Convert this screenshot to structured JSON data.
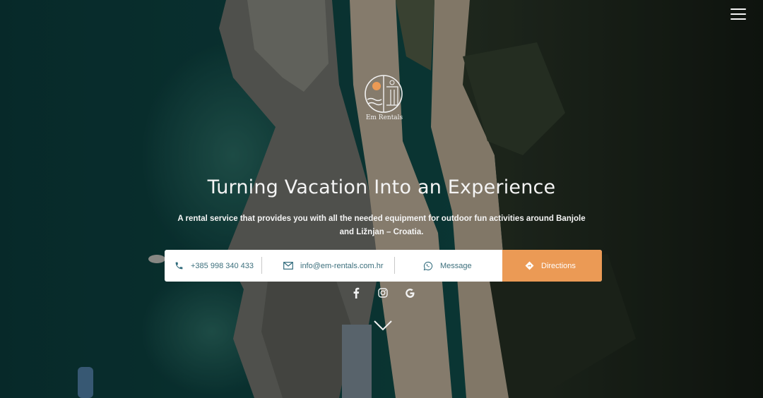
{
  "hero": {
    "title": "Turning Vacation Into an Experience",
    "subtitle": "A rental service that provides you with all the needed equipment for outdoor fun activities around Banjole and Ližnjan – Croatia."
  },
  "logo": {
    "icon": "em-rentals-logo",
    "text": "Em Rentals"
  },
  "menu": {
    "icon": "hamburger-menu-icon"
  },
  "contact": {
    "phone": {
      "icon": "phone-icon",
      "label": "+385 998 340 433"
    },
    "email": {
      "icon": "mail-icon",
      "label": "info@em-rentals.com.hr"
    },
    "message": {
      "icon": "whatsapp-icon",
      "label": "Message"
    },
    "directions": {
      "icon": "directions-icon",
      "label": "Directions"
    }
  },
  "socials": [
    {
      "icon": "facebook-icon"
    },
    {
      "icon": "instagram-icon"
    },
    {
      "icon": "google-icon"
    }
  ],
  "scroll": {
    "icon": "chevron-down-icon"
  },
  "colors": {
    "accent": "#eb9a55",
    "contact_text": "#3c6f7c",
    "title_text": "#f4f4f4"
  }
}
